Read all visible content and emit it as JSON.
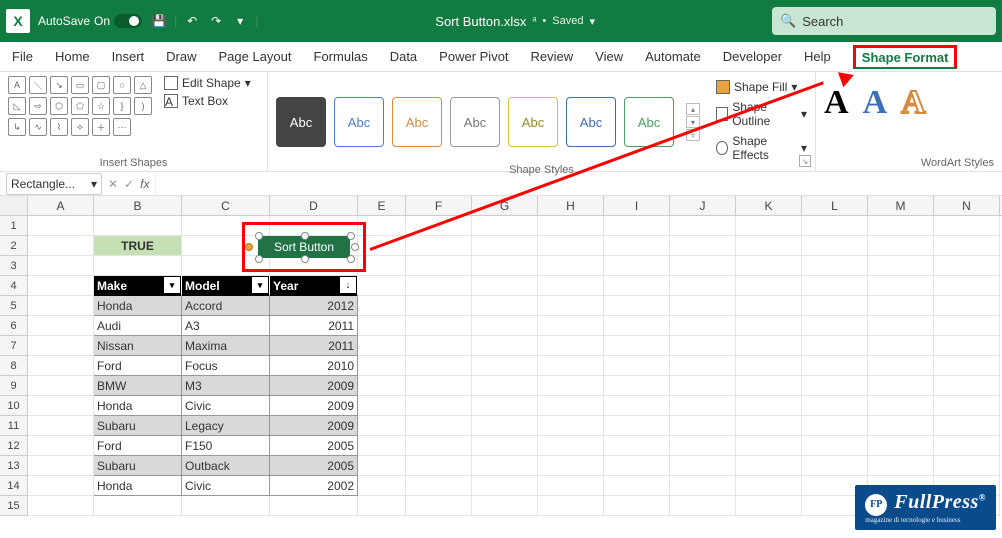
{
  "titlebar": {
    "autosave_label": "AutoSave",
    "autosave_state": "On",
    "filename": "Sort Button.xlsx",
    "saved_label": "Saved",
    "search_placeholder": "Search"
  },
  "tabs": [
    "File",
    "Home",
    "Insert",
    "Draw",
    "Page Layout",
    "Formulas",
    "Data",
    "Power Pivot",
    "Review",
    "View",
    "Automate",
    "Developer",
    "Help",
    "Shape Format"
  ],
  "ribbon": {
    "insert_shapes_label": "Insert Shapes",
    "edit_shape": "Edit Shape",
    "text_box": "Text Box",
    "shape_styles_label": "Shape Styles",
    "abc": "Abc",
    "shape_fill": "Shape Fill",
    "shape_outline": "Shape Outline",
    "shape_effects": "Shape Effects",
    "wordart_label": "WordArt Styles",
    "wa_letter": "A"
  },
  "formula_bar": {
    "name_box": "Rectangle...",
    "fx": "fx"
  },
  "columns": [
    "A",
    "B",
    "C",
    "D",
    "E",
    "F",
    "G",
    "H",
    "I",
    "J",
    "K",
    "L",
    "M",
    "N"
  ],
  "rows": [
    "1",
    "2",
    "3",
    "4",
    "5",
    "6",
    "7",
    "8",
    "9",
    "10",
    "11",
    "12",
    "13",
    "14",
    "15"
  ],
  "sheet": {
    "b2": "TRUE",
    "shape_text": "Sort Button",
    "headers": {
      "make": "Make",
      "model": "Model",
      "year": "Year"
    },
    "data": [
      {
        "make": "Honda",
        "model": "Accord",
        "year": "2012"
      },
      {
        "make": "Audi",
        "model": "A3",
        "year": "2011"
      },
      {
        "make": "Nissan",
        "model": "Maxima",
        "year": "2011"
      },
      {
        "make": "Ford",
        "model": "Focus",
        "year": "2010"
      },
      {
        "make": "BMW",
        "model": "M3",
        "year": "2009"
      },
      {
        "make": "Honda",
        "model": "Civic",
        "year": "2009"
      },
      {
        "make": "Subaru",
        "model": "Legacy",
        "year": "2009"
      },
      {
        "make": "Ford",
        "model": "F150",
        "year": "2005"
      },
      {
        "make": "Subaru",
        "model": "Outback",
        "year": "2005"
      },
      {
        "make": "Honda",
        "model": "Civic",
        "year": "2002"
      }
    ]
  },
  "watermark": {
    "brand": "FullPress",
    "reg": "®",
    "fp": "FP",
    "tag": "magazine di tecnologie e business"
  }
}
